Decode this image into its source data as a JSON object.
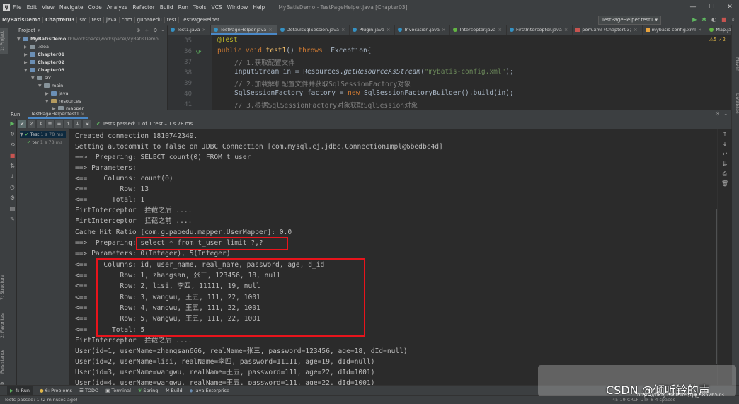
{
  "titlebar": {
    "menu": [
      "File",
      "Edit",
      "View",
      "Navigate",
      "Code",
      "Analyze",
      "Refactor",
      "Build",
      "Run",
      "Tools",
      "VCS",
      "Window",
      "Help"
    ],
    "window_title": "MyBatisDemo - TestPageHelper.java [Chapter03]",
    "controls": [
      "—",
      "☐",
      "✕"
    ]
  },
  "navbar": {
    "crumbs": [
      "MyBatisDemo",
      "Chapter03",
      "src",
      "test",
      "java",
      "com",
      "gupaoedu",
      "test",
      "TestPageHelper"
    ],
    "run_config": "TestPageHelper.test1"
  },
  "project": {
    "title": "Project",
    "root": "MyBatisDemo",
    "root_path": "D:\\workspace\\workspace\\MyBatisDemo",
    "items": [
      ".idea",
      "Chapter01",
      "Chapter02",
      "Chapter03",
      "src",
      "main",
      "java",
      "resources",
      "mapper"
    ]
  },
  "editor": {
    "tabs": [
      "Test1.java",
      "TestPageHelper.java",
      "DefaultSqlSession.java",
      "Plugin.java",
      "Invocation.java",
      "Interceptor.java",
      "FirstInterceptor.java",
      "pom.xml (Chapter03)",
      "mybatis-config.xml",
      "Map.java"
    ],
    "line_numbers": [
      "35",
      "36",
      "37",
      "38",
      "39",
      "40",
      "41"
    ],
    "lines": {
      "l35": "@Test",
      "l36_kw1": "public void ",
      "l36_name": "test1",
      "l36_rest": "() ",
      "l36_kw2": "throws",
      "l36_exc": "  Exception{",
      "l37": "// 1.获取配置文件",
      "l38_a": "InputStream in = Resources.",
      "l38_b": "getResourceAsStream",
      "l38_c": "(",
      "l38_str": "\"mybatis-config.xml\"",
      "l38_d": ");",
      "l39": "// 2.加载解析配置文件并获取SqlSessionFactory对象",
      "l40_a": "SqlSessionFactory factory = ",
      "l40_kw": "new ",
      "l40_b": "SqlSessionFactoryBuilder().build(in);",
      "l41": "// 3.根据SqlSessionFactory对象获取SqlSession对象"
    },
    "inspection": "⚠5 ✓2"
  },
  "run": {
    "label": "Run:",
    "tab": "TestPageHelper.test1",
    "status_prefix": "Tests passed:",
    "status_count": "1",
    "status_suffix": "of 1 test – 1 s 78 ms",
    "tree": [
      {
        "name": "Test",
        "time": "1 s 78 ms"
      },
      {
        "name": "ter",
        "time": "1 s 78 ms"
      }
    ]
  },
  "console": {
    "lines": [
      "Created connection 1810742349.",
      "Setting autocommit to false on JDBC Connection [com.mysql.cj.jdbc.ConnectionImpl@6bedbc4d]",
      "==>  Preparing: SELECT count(0) FROM t_user",
      "==> Parameters: ",
      "<==    Columns: count(0)",
      "<==        Row: 13",
      "<==      Total: 1",
      "FirtInterceptor  拦截之后 ....",
      "FirtInterceptor  拦截之前 ....",
      "Cache Hit Ratio [com.gupaoedu.mapper.UserMapper]: 0.0",
      "==>  Preparing: select * from t_user limit ?,? ",
      "==> Parameters: 0(Integer), 5(Integer)",
      "<==    Columns: id, user_name, real_name, password, age, d_id",
      "<==        Row: 1, zhangsan, 张三, 123456, 18, null",
      "<==        Row: 2, lisi, 李四, 11111, 19, null",
      "<==        Row: 3, wangwu, 王五, 111, 22, 1001",
      "<==        Row: 4, wangwu, 王五, 111, 22, 1001",
      "<==        Row: 5, wangwu, 王五, 111, 22, 1001",
      "<==      Total: 5",
      "FirtInterceptor  拦截之后 ....",
      "User(id=1, userName=zhangsan666, realName=张三, password=123456, age=18, dId=null)",
      "User(id=2, userName=lisi, realName=李四, password=11111, age=19, dId=null)",
      "User(id=3, userName=wangwu, realName=王五, password=111, age=22, dId=1001)",
      "User(id=4, userName=wangwu, realName=王五, password=111, age=22, dId=1001)"
    ]
  },
  "bottom_tabs": [
    "4: Run",
    "6: Problems",
    "TODO",
    "Terminal",
    "Spring",
    "Build",
    "Java Enterprise"
  ],
  "left_tabs": [
    "1: Project",
    "7: Structure",
    "2: Favorites",
    "Persistence",
    "Web"
  ],
  "right_tabs": [
    "Maven",
    "Database"
  ],
  "statusbar": {
    "text": "Tests passed: 1 (2 minutes ago)",
    "right": "45:19  CRLF  UTF-8  4 spaces"
  },
  "watermark": {
    "text": "CSDN @倾听铃的声",
    "sub": "https://blog.csdn.net/qq_38526573"
  },
  "colors": {
    "highlight_box": "#e8141c",
    "pass_green": "#5fb760",
    "accent_blue": "#4a88c7"
  }
}
